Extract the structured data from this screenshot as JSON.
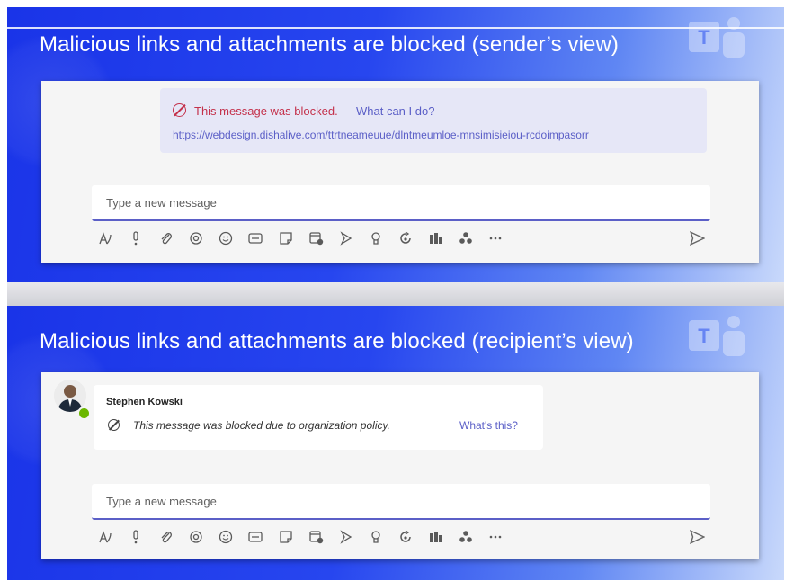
{
  "sender_view": {
    "title": "Malicious links and attachments are blocked (sender’s view)",
    "blocked_text": "This message was blocked.",
    "what_link": "What can I do?",
    "url": "https://webdesign.dishalive.com/ttrtneameuue/dlntmeumloe-mnsimisieiou-rcdoimpasorr",
    "input_placeholder": "Type a new message"
  },
  "recipient_view": {
    "title": "Malicious links and attachments are blocked (recipient’s view)",
    "sender_name": "Stephen Kowski",
    "blocked_text": "This message was blocked due to organization policy.",
    "whats_this": "What's this?",
    "input_placeholder": "Type a new message"
  },
  "toolbar_icons": [
    "format-icon",
    "priority-icon",
    "attach-icon",
    "loop-icon",
    "emoji-icon",
    "gif-icon",
    "sticker-icon",
    "schedule-meeting-icon",
    "stream-icon",
    "praise-icon",
    "approvals-icon",
    "updates-icon",
    "apps-icon",
    "more-options-icon"
  ],
  "colors": {
    "accent": "#5b5fc7",
    "blocked": "#c4314b",
    "presence": "#6bb700",
    "slide_blue": "#1a34e8"
  }
}
